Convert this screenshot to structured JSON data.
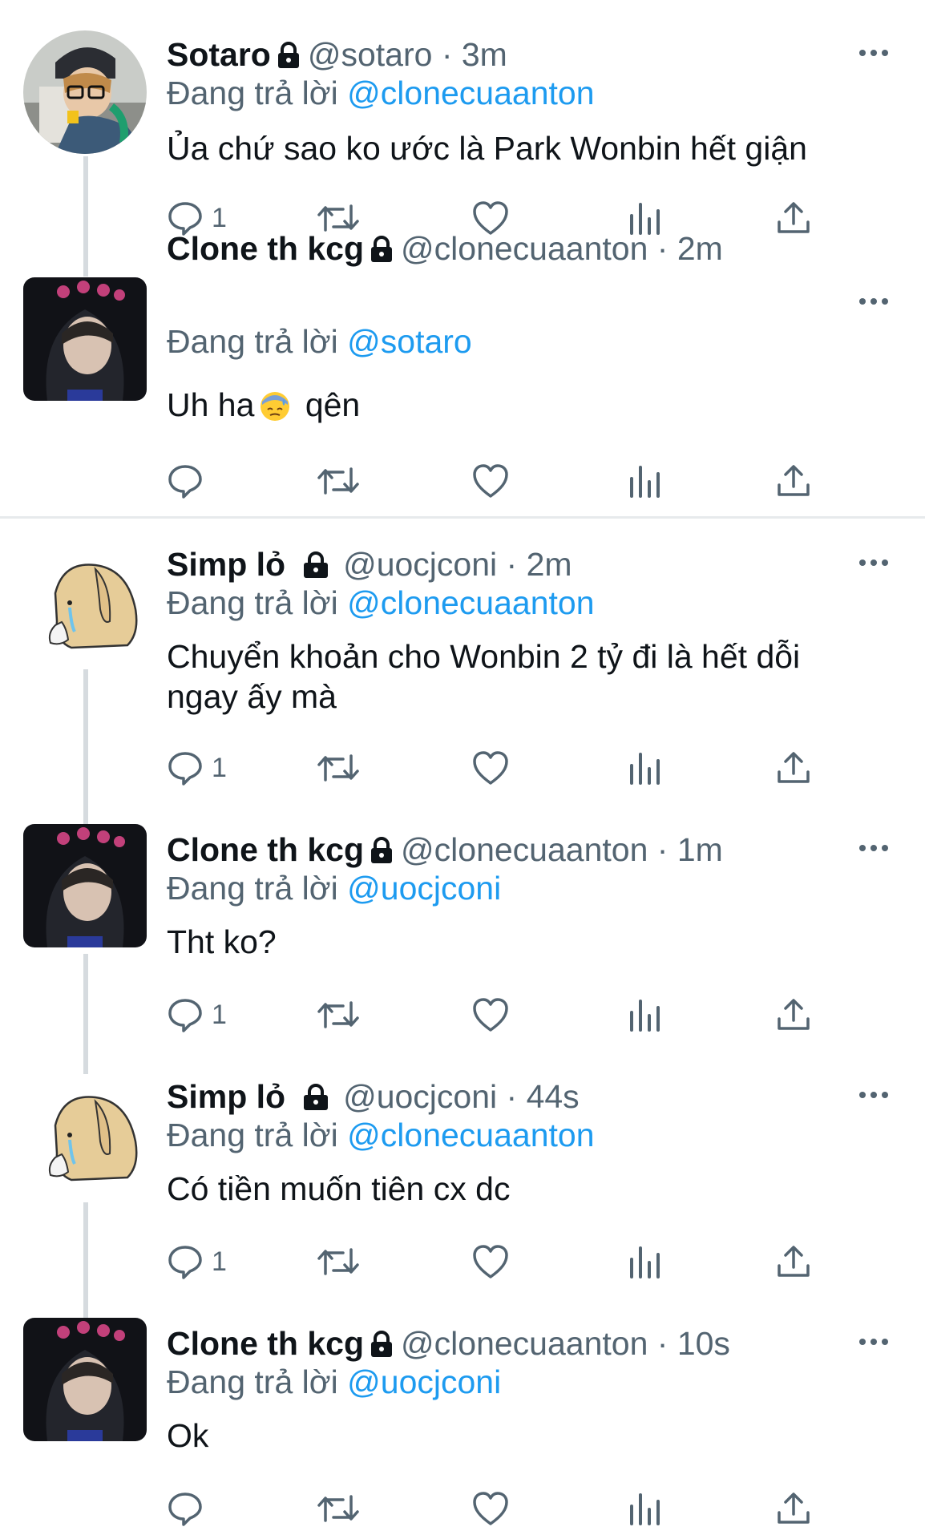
{
  "reply_prefix": "Đang trả lời",
  "tweets": [
    {
      "name": "Sotaro",
      "handle": "@sotaro",
      "time": "3m",
      "reply_to": "@clonecuaanton",
      "text": "Ủa chứ sao ko ước là Park Wonbin hết giận",
      "reply_count": "1"
    },
    {
      "name": "Clone th kcg",
      "handle": "@clonecuaanton",
      "time": "2m",
      "reply_to": "@sotaro",
      "text_before": "Uh ha",
      "text_emoji": "downcast-face-with-sweat",
      "text_after": "qên",
      "reply_count": ""
    },
    {
      "name": "Simp lỏ",
      "handle": "@uocjconi",
      "time": "2m",
      "reply_to": "@clonecuaanton",
      "text": "Chuyển khoản cho Wonbin 2 tỷ đi là hết dỗi ngay ấy mà",
      "reply_count": "1"
    },
    {
      "name": "Clone th kcg",
      "handle": "@clonecuaanton",
      "time": "1m",
      "reply_to": "@uocjconi",
      "text": "Tht ko?",
      "reply_count": "1"
    },
    {
      "name": "Simp lỏ",
      "handle": "@uocjconi",
      "time": "44s",
      "reply_to": "@clonecuaanton",
      "text": "Có tiền muốn tiên cx dc",
      "reply_count": "1"
    },
    {
      "name": "Clone th kcg",
      "handle": "@clonecuaanton",
      "time": "10s",
      "reply_to": "@uocjconi",
      "text": "Ok",
      "reply_count": ""
    }
  ],
  "icons": {
    "reply": "reply-icon",
    "retweet": "retweet-icon",
    "like": "like-icon",
    "views": "views-icon",
    "share": "share-icon",
    "more": "more-icon",
    "lock": "lock-icon"
  },
  "colors": {
    "mention": "#1d9bf0",
    "secondary": "#536471",
    "text": "#0f1419",
    "line": "#d6dbdf"
  }
}
